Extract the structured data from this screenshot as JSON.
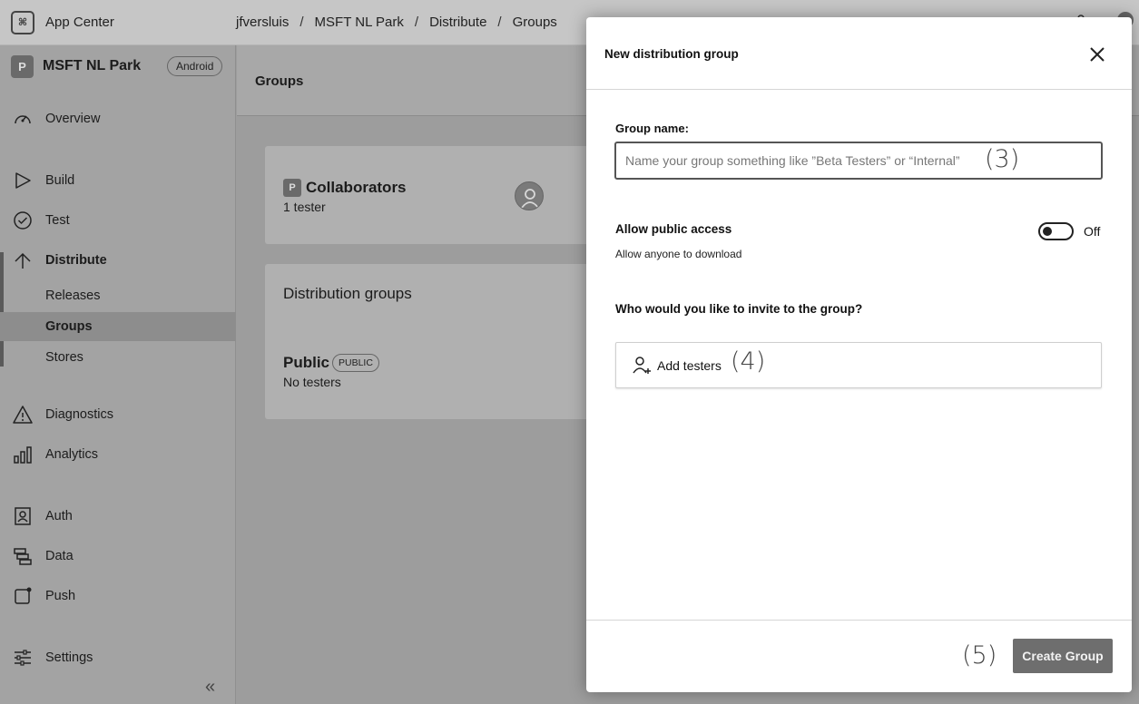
{
  "topbar": {
    "app_title": "App Center",
    "breadcrumbs": [
      "jfversluis",
      "MSFT NL Park",
      "Distribute",
      "Groups"
    ],
    "separator": "/"
  },
  "sidebar": {
    "project_logo": "P",
    "project_name": "MSFT NL Park",
    "platform": "Android",
    "items": [
      {
        "label": "Overview",
        "icon": "speedometer-icon"
      },
      {
        "label": "Build",
        "icon": "play-icon"
      },
      {
        "label": "Test",
        "icon": "check-circle-icon"
      },
      {
        "label": "Distribute",
        "icon": "distribute-icon"
      },
      {
        "label": "Diagnostics",
        "icon": "warning-icon"
      },
      {
        "label": "Analytics",
        "icon": "bar-chart-icon"
      },
      {
        "label": "Auth",
        "icon": "id-card-icon"
      },
      {
        "label": "Data",
        "icon": "database-icon"
      },
      {
        "label": "Push",
        "icon": "push-icon"
      },
      {
        "label": "Settings",
        "icon": "sliders-icon"
      }
    ],
    "distribute_sub": [
      {
        "label": "Releases"
      },
      {
        "label": "Groups"
      },
      {
        "label": "Stores"
      }
    ],
    "collapse_glyph": "«"
  },
  "main": {
    "title": "Groups",
    "collaborators": {
      "logo": "P",
      "title": "Collaborators",
      "subtitle": "1 tester"
    },
    "distribution_groups": {
      "title": "Distribution groups",
      "public_title": "Public",
      "public_badge": "PUBLIC",
      "public_subtitle": "No testers"
    }
  },
  "modal": {
    "title": "New distribution group",
    "group_name_label": "Group name:",
    "group_name_value": "",
    "group_name_placeholder": "Name your group something like ”Beta Testers” or “Internal”",
    "public_access_label": "Allow public access",
    "public_access_sub": "Allow anyone to download",
    "public_access_state": "Off",
    "invite_label": "Who would you like to invite to the group?",
    "add_testers_label": "Add testers",
    "create_button_label": "Create Group"
  },
  "annotations": {
    "step3": "(3)",
    "step4": "(4)",
    "step5": "(5)"
  }
}
